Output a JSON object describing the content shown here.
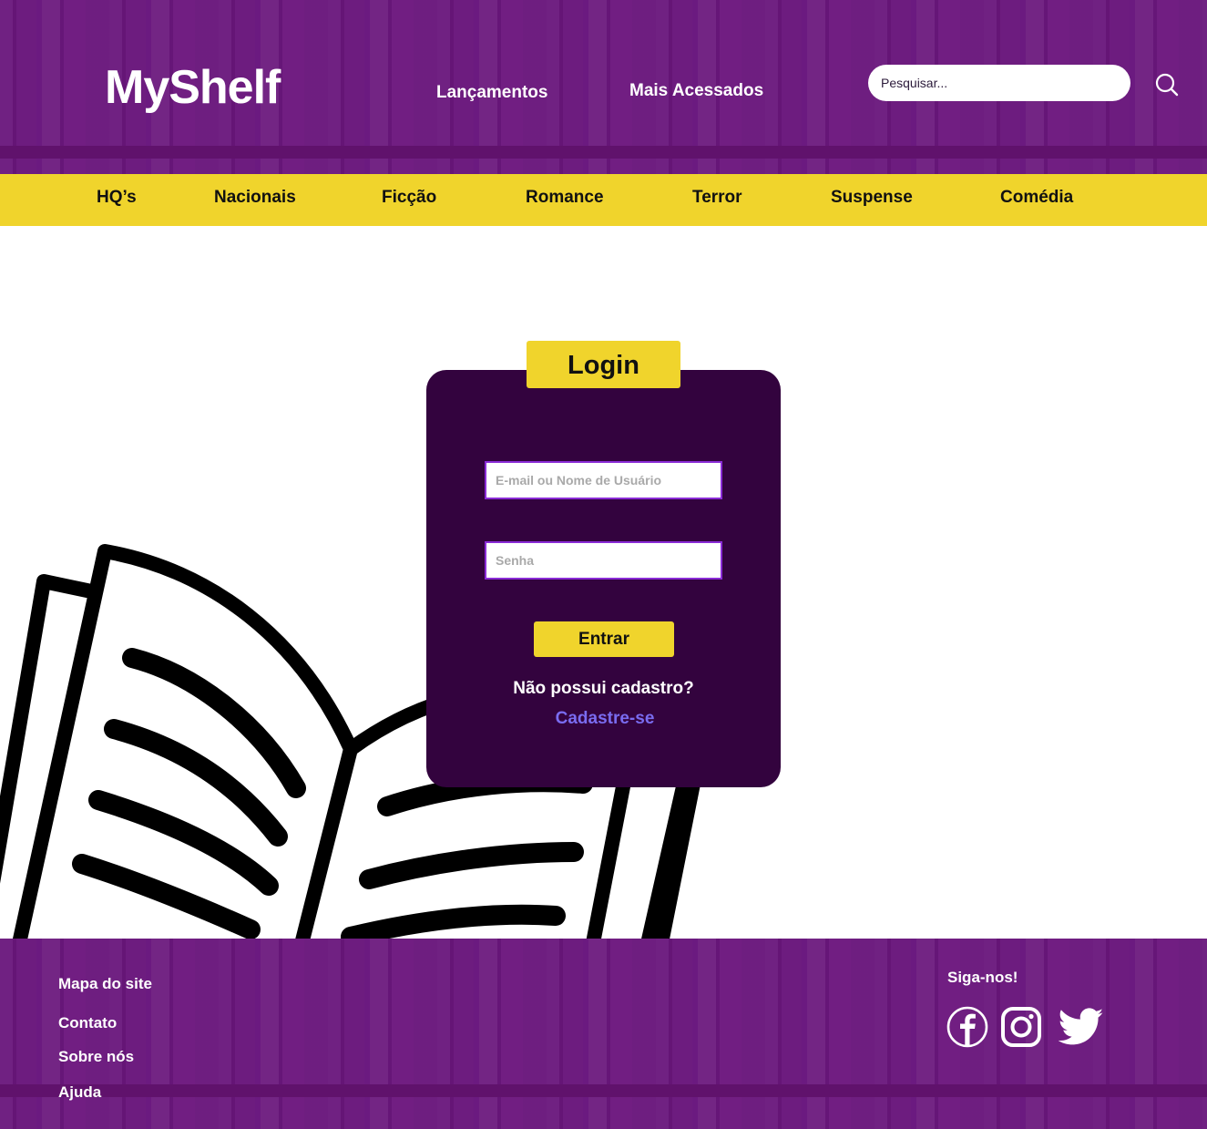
{
  "brand": {
    "logo_text": "MyShelf"
  },
  "header": {
    "nav": {
      "lancamentos": "Lançamentos",
      "mais_acessados": "Mais Acessados"
    },
    "search": {
      "placeholder": "Pesquisar..."
    }
  },
  "categories": [
    "HQ’s",
    "Nacionais",
    "Ficção",
    "Romance",
    "Terror",
    "Suspense",
    "Comédia"
  ],
  "login": {
    "title": "Login",
    "email_placeholder": "E-mail ou Nome de Usuário",
    "password_placeholder": "Senha",
    "submit_label": "Entrar",
    "no_account_text": "Não possui cadastro?",
    "signup_label": "Cadastre-se"
  },
  "footer": {
    "links": [
      "Mapa do site",
      "Contato",
      "Sobre nós",
      "Ajuda"
    ],
    "follow_label": "Siga-nos!",
    "social": [
      "facebook-icon",
      "instagram-icon",
      "twitter-icon"
    ]
  },
  "colors": {
    "purple_header": "#6a1b7a",
    "category_yellow": "#f0d42c",
    "login_card": "#33033e",
    "signup_link": "#7a6cf0"
  }
}
